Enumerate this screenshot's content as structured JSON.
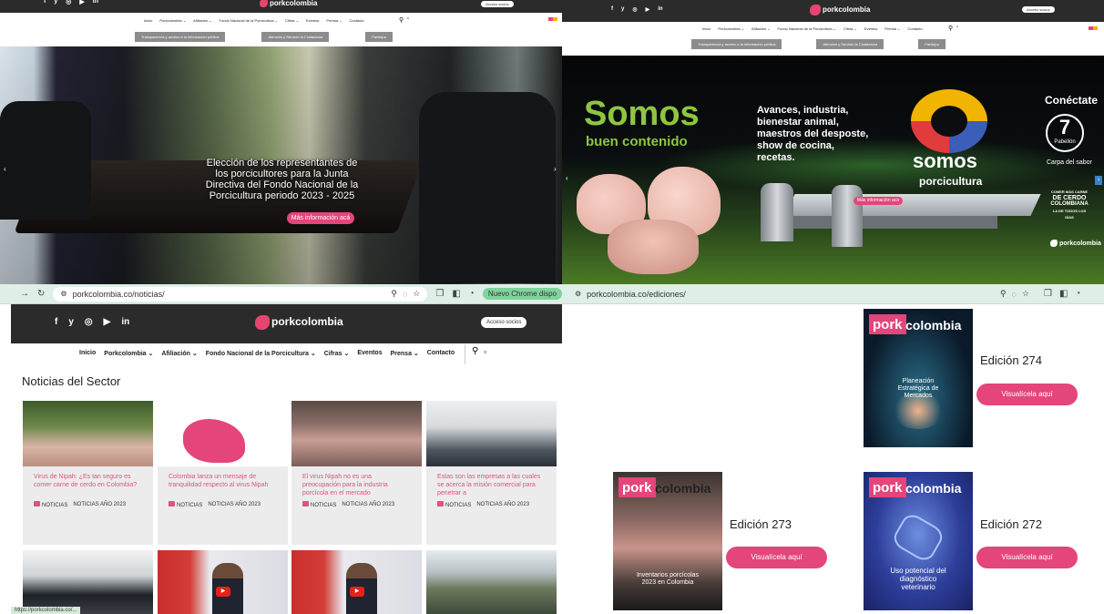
{
  "social_icons": [
    "facebook-icon",
    "twitter-icon",
    "instagram-icon",
    "youtube-icon",
    "linkedin-icon"
  ],
  "social_glyphs": [
    "f",
    "y",
    "◎",
    "▶",
    "in"
  ],
  "brand": {
    "logo_text": "porkcolombia",
    "accent": "#e4457a",
    "dark": "#2b2b2b"
  },
  "account_button": "Acceso socios",
  "nav": {
    "items": [
      "Inicio",
      "Porkcolombia ⌄",
      "Afiliación ⌄",
      "Fondo Nacional de la Porcicultura ⌄",
      "Cifras ⌄",
      "Eventos",
      "Prensa ⌄",
      "Contacto"
    ]
  },
  "quick_links": [
    "Transparencia y acceso a la información pública",
    "Atención y Servicio la Ciudadanía",
    "Participa"
  ],
  "q1": {
    "hero_text": "Elección de los representantes de los porcicultores para la Junta Directiva del Fondo Nacional de la Porcicultura periodo 2023 - 2025",
    "button": "Más información acá"
  },
  "q2": {
    "headline1": "Somos",
    "headline2": "buen contenido",
    "body": "Avances, industria, bienestar animal, maestros del desposte, show de cocina, recetas.",
    "brand_big": "somos",
    "brand_small": "porcicultura",
    "connect": "Conéctate",
    "pavilion_number": "7",
    "pavilion": "Pabellón",
    "pavilion_sub": "Carpa del sabor",
    "badge_line1": "COMER MÁS CARNE",
    "badge_line2": "DE CERDO",
    "badge_line3": "COLOMBIANA",
    "badge_line4": "LA DE TODOS LOS DÍAS",
    "button": "Más información acá"
  },
  "q3": {
    "url": "porkcolombia.co/noticias/",
    "chrome_badge": "Nuevo Chrome dispo",
    "section_title": "Noticias del Sector",
    "cards": [
      {
        "title": "Virus de Nipah: ¿Es tan seguro es comer carne de cerdo en Colombia?",
        "tag1": "NOTICIAS",
        "tag2": "NOTICIAS AÑO 2023"
      },
      {
        "title": "Colombia lanza un mensaje de tranquilidad respecto al virus Nipah",
        "tag1": "NOTICIAS",
        "tag2": "NOTICIAS AÑO 2023"
      },
      {
        "title": "El virus Nipah no es una preocupación para la industria porcícola en el mercado",
        "tag1": "NOTICIAS",
        "tag2": "NOTICIAS AÑO 2023"
      },
      {
        "title": "Estas son las empresas a las cuales se acerca la misión comercial para penetrar a",
        "tag1": "NOTICIAS",
        "tag2": "NOTICIAS AÑO 2023"
      }
    ],
    "status_text": "https://porkcolombia.co/..."
  },
  "q4": {
    "url": "porkcolombia.co/ediciones/",
    "editions": [
      {
        "label": "Edición 274",
        "cover_text": "Planeación Estratégica de Mercados",
        "button": "Visualícela aquí"
      },
      {
        "label": "Edición 273",
        "cover_text": "Inventarios porcícolas 2023 en Colombia",
        "button": "Visualícela aquí"
      },
      {
        "label": "Edición 272",
        "cover_text": "Uso potencial del diagnóstico veterinario",
        "button": "Visualícela aquí"
      }
    ],
    "mast_pork": "pork",
    "mast_colombia": "colombia"
  }
}
